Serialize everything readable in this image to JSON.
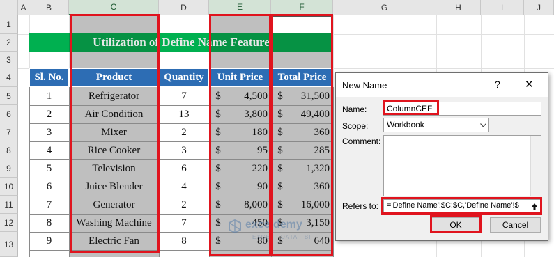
{
  "sheet": {
    "columns": [
      "A",
      "B",
      "C",
      "D",
      "E",
      "F",
      "G",
      "H",
      "I",
      "J"
    ],
    "rows": [
      "1",
      "2",
      "3",
      "4",
      "5",
      "6",
      "7",
      "8",
      "9",
      "10",
      "11",
      "12",
      "13"
    ],
    "title": "Utilization of Define Name Feature",
    "table": {
      "headers": [
        "Sl. No.",
        "Product",
        "Quantity",
        "Unit Price",
        "Total Price"
      ],
      "rows": [
        {
          "sl": "1",
          "product": "Refrigerator",
          "qty": "7",
          "unit": "4,500",
          "total": "31,500"
        },
        {
          "sl": "2",
          "product": "Air Condition",
          "qty": "13",
          "unit": "3,800",
          "total": "49,400"
        },
        {
          "sl": "3",
          "product": "Mixer",
          "qty": "2",
          "unit": "180",
          "total": "360"
        },
        {
          "sl": "4",
          "product": "Rice Cooker",
          "qty": "3",
          "unit": "95",
          "total": "285"
        },
        {
          "sl": "5",
          "product": "Television",
          "qty": "6",
          "unit": "220",
          "total": "1,320"
        },
        {
          "sl": "6",
          "product": "Juice Blender",
          "qty": "4",
          "unit": "90",
          "total": "360"
        },
        {
          "sl": "7",
          "product": "Generator",
          "qty": "2",
          "unit": "8,000",
          "total": "16,000"
        },
        {
          "sl": "8",
          "product": "Washing Machine",
          "qty": "7",
          "unit": "450",
          "total": "3,150"
        },
        {
          "sl": "9",
          "product": "Electric Fan",
          "qty": "8",
          "unit": "80",
          "total": "640"
        }
      ],
      "currency_symbol": "$"
    }
  },
  "dialog": {
    "title": "New Name",
    "help": "?",
    "close": "✕",
    "name_label": "Name:",
    "name_value": "ColumnCEF",
    "scope_label": "Scope:",
    "scope_value": "Workbook",
    "comment_label": "Comment:",
    "comment_value": "",
    "refers_label": "Refers to:",
    "refers_value": "='Define Name'!$C:$C,'Define Name'!$",
    "ok": "OK",
    "cancel": "Cancel"
  },
  "watermark": {
    "brand": "exceldemy",
    "tagline": "EXCEL · DATA · BI"
  },
  "colors": {
    "title_bg": "#00b050",
    "header_bg": "#2d6db4",
    "selection_fill": "#bfbfbf",
    "highlight_red": "#e0141e"
  }
}
